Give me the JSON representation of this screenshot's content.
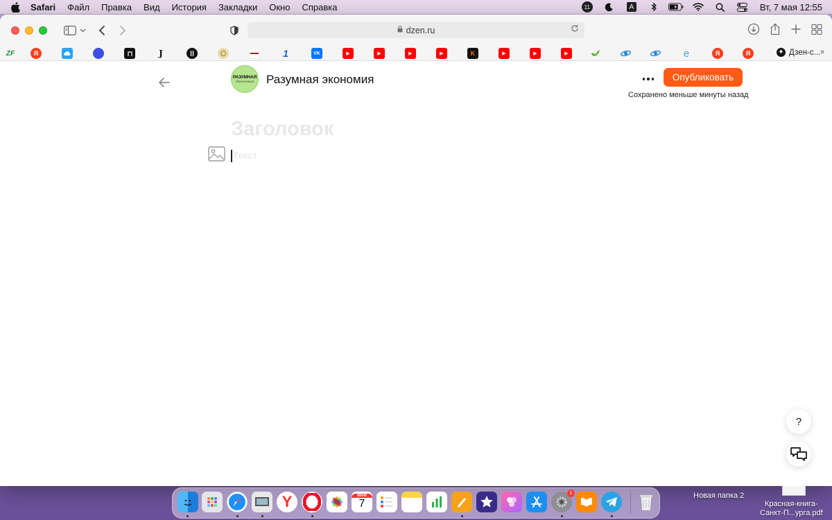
{
  "menubar": {
    "app_name": "Safari",
    "items": [
      "Файл",
      "Правка",
      "Вид",
      "История",
      "Закладки",
      "Окно",
      "Справка"
    ],
    "status": {
      "notification_count": "11",
      "input_source": "A",
      "clock": "Вт, 7 мая  12:55"
    }
  },
  "browser": {
    "url": "dzen.ru",
    "favorites": [
      {
        "icon": "zf-icon",
        "label": "ZF"
      },
      {
        "icon": "yandex-icon",
        "label": "Я"
      },
      {
        "icon": "cloud-icon",
        "label": ""
      },
      {
        "icon": "blue-circle-icon",
        "label": ""
      },
      {
        "icon": "dark-square-icon",
        "label": ""
      },
      {
        "icon": "journal-icon",
        "label": ""
      },
      {
        "icon": "round-logo-icon",
        "label": ""
      },
      {
        "icon": "emblem-icon",
        "label": ""
      },
      {
        "icon": "canon-icon",
        "label": ""
      },
      {
        "icon": "channel-one-icon",
        "label": "1"
      },
      {
        "icon": "vk-icon",
        "label": "VK"
      },
      {
        "icon": "youtube-icon",
        "label": "▶"
      },
      {
        "icon": "youtube-icon",
        "label": "▶"
      },
      {
        "icon": "youtube-icon",
        "label": "▶"
      },
      {
        "icon": "youtube-icon",
        "label": "▶"
      },
      {
        "icon": "k-icon",
        "label": "K"
      },
      {
        "icon": "youtube-icon",
        "label": "▶"
      },
      {
        "icon": "youtube-icon",
        "label": "▶"
      },
      {
        "icon": "youtube-icon",
        "label": "▶"
      },
      {
        "icon": "bird-icon",
        "label": ""
      },
      {
        "icon": "ie-icon",
        "label": ""
      },
      {
        "icon": "ie-icon",
        "label": ""
      },
      {
        "icon": "edge-icon",
        "label": "e"
      },
      {
        "icon": "yandex-icon",
        "label": "Я"
      },
      {
        "icon": "yandex-icon",
        "label": "Я"
      }
    ],
    "favorites_last_label": "Дзен-с...",
    "favorites_more": "»"
  },
  "editor": {
    "channel_logo_line1": "РАЗУМНАЯ",
    "channel_logo_line2": "Экономия",
    "channel_name": "Разумная экономия",
    "publish_label": "Опубликовать",
    "saved_status": "Сохранено меньше минуты назад",
    "title_placeholder": "Заголовок",
    "text_placeholder": "Текст",
    "help_label": "?"
  },
  "dock": {
    "calendar_month": "МАЙ",
    "calendar_day": "7",
    "settings_badge": "1"
  },
  "desktop": {
    "folder_label": "Новая папка 2",
    "file_label_line1": "Красная-книга-",
    "file_label_line2": "Санкт-П...урга.pdf"
  },
  "colors": {
    "accent": "#ff5b14",
    "menubar_bg": "#e9d8ec",
    "channel_logo_bg": "#b7e58f"
  }
}
